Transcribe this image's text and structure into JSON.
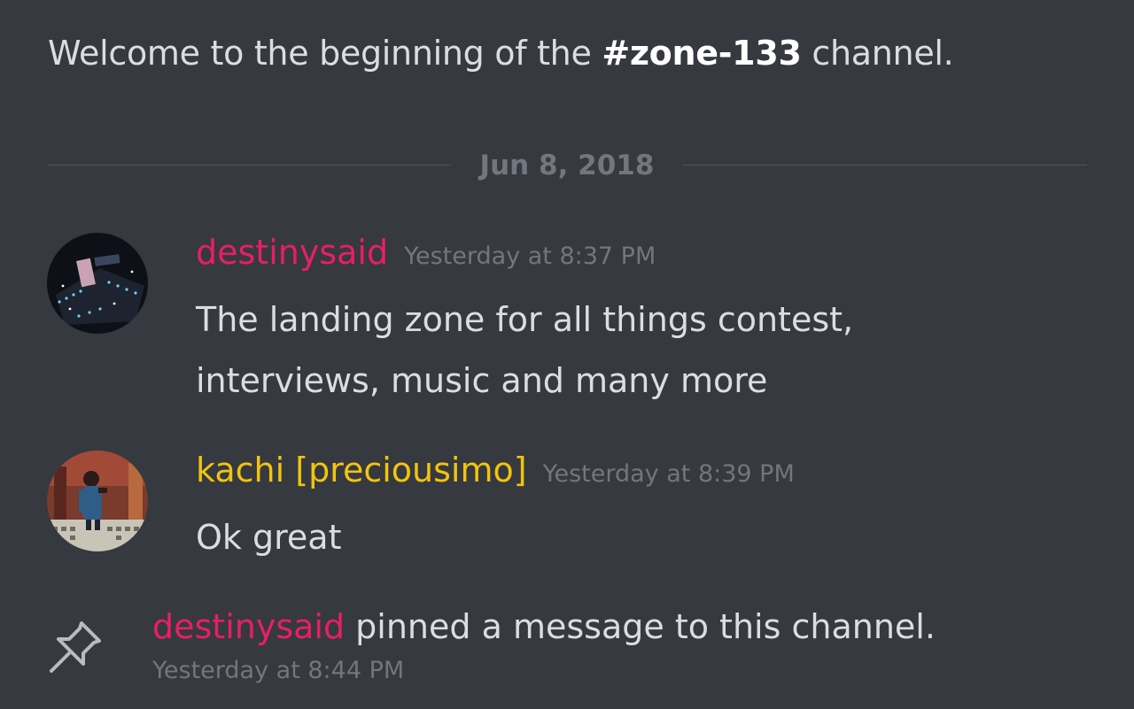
{
  "channel": {
    "welcome_prefix": "Welcome to the beginning of the ",
    "channel_name": "#zone-133",
    "welcome_suffix": " channel."
  },
  "date_divider": "Jun 8, 2018",
  "messages": [
    {
      "author": "destinysaid",
      "author_color": "#e91e63",
      "timestamp": "Yesterday at 8:37 PM",
      "lines": [
        "The landing zone for all things contest,",
        "interviews, music and many more"
      ],
      "avatar": "neon-lights-avatar"
    },
    {
      "author": "kachi [preciousimo]",
      "author_color": "#f1c40f",
      "timestamp": "Yesterday at 8:39 PM",
      "lines": [
        "Ok great"
      ],
      "avatar": "person-selfie-avatar"
    }
  ],
  "system_message": {
    "actor": "destinysaid",
    "actor_color": "#e91e63",
    "text": " pinned a message to this channel.",
    "timestamp": "Yesterday at 8:44 PM",
    "icon": "pin-icon"
  }
}
